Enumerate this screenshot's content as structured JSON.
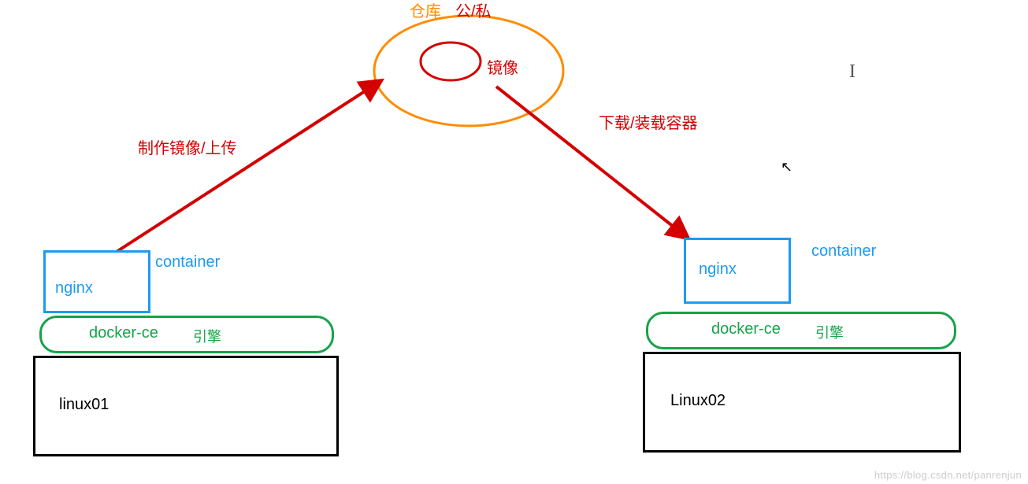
{
  "repo": {
    "title": "仓库",
    "scope": "公/私",
    "image_label": "镜像"
  },
  "arrows": {
    "upload": "制作镜像/上传",
    "download": "下载/装载容器"
  },
  "left": {
    "container_text": "nginx",
    "container_tag": "container",
    "engine_name": "docker-ce",
    "engine_tag": "引擎",
    "os": "linux01"
  },
  "right": {
    "container_text": "nginx",
    "container_tag": "container",
    "engine_name": "docker-ce",
    "engine_tag": "引擎",
    "os": "Linux02"
  },
  "colors": {
    "blue": "#1d9bf0",
    "green": "#16a34a",
    "black": "#000000",
    "red": "#d40000",
    "orange": "#ff8c00"
  },
  "watermark": "https://blog.csdn.net/panrenjun"
}
